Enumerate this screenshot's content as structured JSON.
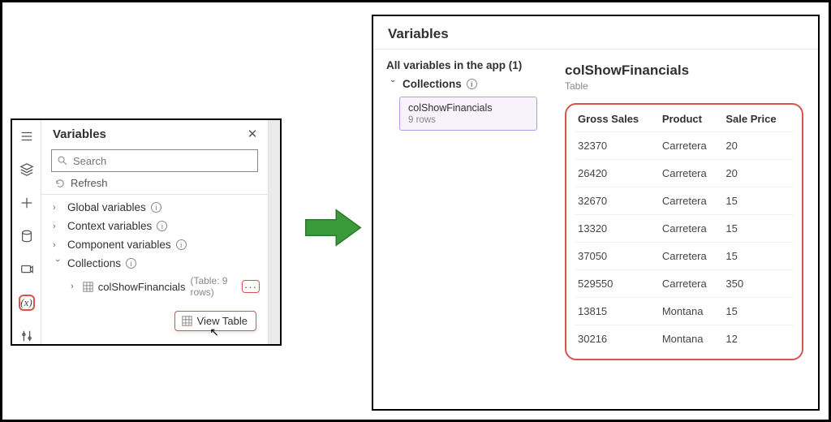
{
  "leftPanel": {
    "title": "Variables",
    "searchPlaceholder": "Search",
    "refreshLabel": "Refresh",
    "sections": {
      "global": "Global variables",
      "context": "Context variables",
      "component": "Component variables",
      "collections": "Collections"
    },
    "collectionItem": {
      "name": "colShowFinancials",
      "meta": "(Table: 9 rows)"
    },
    "viewTableLabel": "View Table"
  },
  "rightPanel": {
    "title": "Variables",
    "allVarsHeader": "All variables in the app (1)",
    "collectionsLabel": "Collections",
    "selected": {
      "name": "colShowFinancials",
      "rows": "9 rows"
    },
    "detailTitle": "colShowFinancials",
    "detailSub": "Table",
    "columns": [
      "Gross Sales",
      "Product",
      "Sale Price"
    ],
    "rows": [
      {
        "gs": "32370",
        "p": "Carretera",
        "sp": "20"
      },
      {
        "gs": "26420",
        "p": "Carretera",
        "sp": "20"
      },
      {
        "gs": "32670",
        "p": "Carretera",
        "sp": "15"
      },
      {
        "gs": "13320",
        "p": "Carretera",
        "sp": "15"
      },
      {
        "gs": "37050",
        "p": "Carretera",
        "sp": "15"
      },
      {
        "gs": "529550",
        "p": "Carretera",
        "sp": "350"
      },
      {
        "gs": "13815",
        "p": "Montana",
        "sp": "15"
      },
      {
        "gs": "30216",
        "p": "Montana",
        "sp": "12"
      }
    ]
  },
  "chart_data": {
    "type": "table",
    "title": "colShowFinancials",
    "columns": [
      "Gross Sales",
      "Product",
      "Sale Price"
    ],
    "rows": [
      [
        32370,
        "Carretera",
        20
      ],
      [
        26420,
        "Carretera",
        20
      ],
      [
        32670,
        "Carretera",
        15
      ],
      [
        13320,
        "Carretera",
        15
      ],
      [
        37050,
        "Carretera",
        15
      ],
      [
        529550,
        "Carretera",
        350
      ],
      [
        13815,
        "Montana",
        15
      ],
      [
        30216,
        "Montana",
        12
      ]
    ]
  }
}
